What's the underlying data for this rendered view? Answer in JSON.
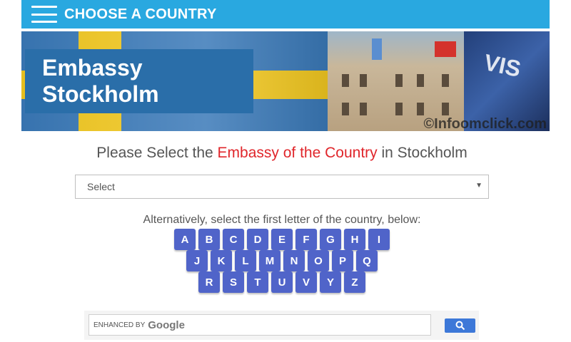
{
  "topbar": {
    "title": "CHOOSE A COUNTRY"
  },
  "banner": {
    "title": "Embassy Stockholm",
    "watermark": "©Infoomclick.com",
    "visa_text": "VIS"
  },
  "heading": {
    "prefix": "Please Select the ",
    "accent": "Embassy of the Country",
    "suffix": " in Stockholm"
  },
  "select": {
    "value": "Select"
  },
  "alt_text": "Alternatively, select the first letter of the country, below:",
  "letters": {
    "row1": [
      "A",
      "B",
      "C",
      "D",
      "E",
      "F",
      "G",
      "H",
      "I"
    ],
    "row2": [
      "J",
      "K",
      "L",
      "M",
      "N",
      "O",
      "P",
      "Q"
    ],
    "row3": [
      "R",
      "S",
      "T",
      "U",
      "V",
      "Y",
      "Z"
    ]
  },
  "search": {
    "enhanced_label": "ENHANCED BY",
    "google_label": "Google"
  },
  "colors": {
    "topbar": "#29a8e0",
    "banner_label": "#2a6ea9",
    "accent": "#e0262b",
    "letter_button": "#5064c9",
    "search_button": "#3d78d8"
  },
  "icons": {
    "menu": "hamburger-menu-icon",
    "dropdown": "chevron-down-icon",
    "search": "search-icon"
  }
}
